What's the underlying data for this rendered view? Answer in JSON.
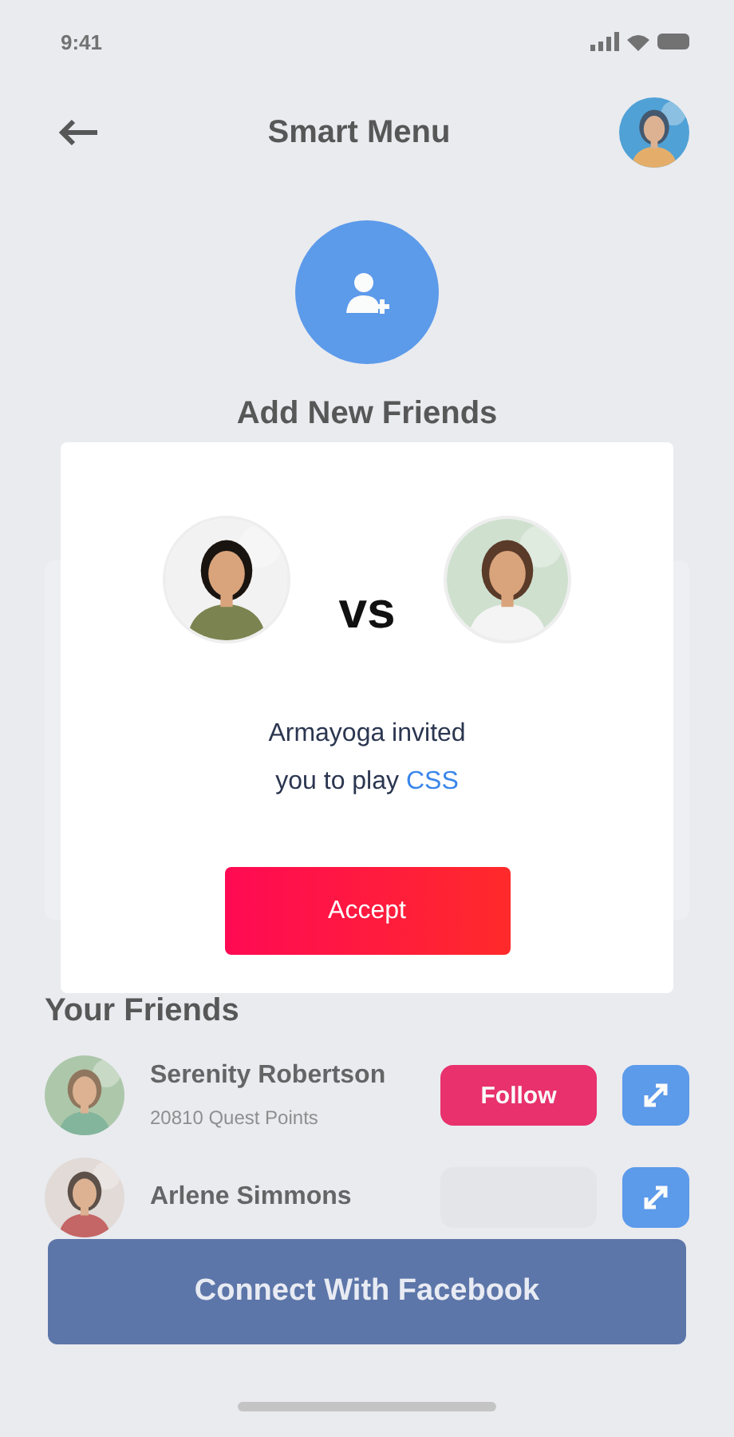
{
  "status_bar": {
    "time": "9:41"
  },
  "header": {
    "title": "Smart Menu"
  },
  "add_friends": {
    "label": "Add New Friends"
  },
  "friends": {
    "title": "Your Friends",
    "items": [
      {
        "name": "Serenity Robertson",
        "points": "20810 Quest Points",
        "action": "Follow"
      },
      {
        "name": "Arlene Simmons"
      }
    ]
  },
  "facebook_button": "Connect With Facebook",
  "dialog": {
    "vs": "vs",
    "line_1": "Armayoga invited",
    "line_2": "you to play",
    "game": "CSS",
    "button": "Accept"
  }
}
